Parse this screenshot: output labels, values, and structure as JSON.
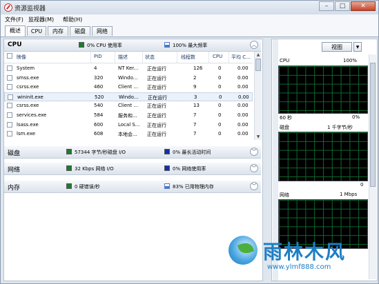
{
  "window": {
    "title": "资源监视器",
    "minimize": "–",
    "maximize": "□",
    "close": "✕"
  },
  "menu": [
    "文件(F)",
    "监视器(M)",
    "帮助(H)"
  ],
  "tabs": [
    "概述",
    "CPU",
    "内存",
    "磁盘",
    "网络"
  ],
  "cpu_section": {
    "title": "CPU",
    "stat1": "0% CPU 使用率",
    "stat2": "100% 最大频率",
    "columns": [
      "映像",
      "PID",
      "描述",
      "状态",
      "线程数",
      "CPU",
      "平均 C..."
    ],
    "rows": [
      {
        "image": "System",
        "pid": "4",
        "desc": "NT Ker...",
        "status": "正在运行",
        "threads": "126",
        "cpu": "0",
        "avg": "0.00"
      },
      {
        "image": "smss.exe",
        "pid": "320",
        "desc": "Windo...",
        "status": "正在运行",
        "threads": "2",
        "cpu": "0",
        "avg": "0.00"
      },
      {
        "image": "csrss.exe",
        "pid": "460",
        "desc": "Client ...",
        "status": "正在运行",
        "threads": "9",
        "cpu": "0",
        "avg": "0.00"
      },
      {
        "image": "wininit.exe",
        "pid": "520",
        "desc": "Windo...",
        "status": "正在运行",
        "threads": "3",
        "cpu": "0",
        "avg": "0.00"
      },
      {
        "image": "csrss.exe",
        "pid": "540",
        "desc": "Client ...",
        "status": "正在运行",
        "threads": "13",
        "cpu": "0",
        "avg": "0.00"
      },
      {
        "image": "services.exe",
        "pid": "584",
        "desc": "服务和...",
        "status": "正在运行",
        "threads": "7",
        "cpu": "0",
        "avg": "0.00"
      },
      {
        "image": "lsass.exe",
        "pid": "600",
        "desc": "Local S...",
        "status": "正在运行",
        "threads": "7",
        "cpu": "0",
        "avg": "0.00"
      },
      {
        "image": "lsm.exe",
        "pid": "608",
        "desc": "本地会...",
        "status": "正在运行",
        "threads": "7",
        "cpu": "0",
        "avg": "0.00"
      }
    ]
  },
  "disk_section": {
    "title": "磁盘",
    "stat1": "57344 字节/秒磁盘 I/O",
    "stat2": "0% 最长活动时间"
  },
  "network_section": {
    "title": "网络",
    "stat1": "32 Kbps 网络 I/O",
    "stat2": "0% 网络使用率"
  },
  "memory_section": {
    "title": "内存",
    "stat1": "0 硬错误/秒",
    "stat2": "83% 已用物理内存"
  },
  "right_panel": {
    "view_label": "视图",
    "dropdown_arrow": "▼",
    "cpu_graph": {
      "name": "CPU",
      "max": "100%",
      "time": "60 秒",
      "min": "0%"
    },
    "disk_graph": {
      "name": "磁盘",
      "max": "1 千字节/秒",
      "min": "0"
    },
    "network_graph": {
      "name": "网络",
      "max": "1 Mbps"
    }
  },
  "watermark": {
    "text": "雨林木风",
    "url": "www.ylmf888.com"
  },
  "colors": {
    "graph_bg": "#000000",
    "graph_grid": "#0e6a2d",
    "cpu_green": "#1e7b2e",
    "disk_blue": "#1430a8",
    "brand_blue": "#1d7ec4"
  }
}
